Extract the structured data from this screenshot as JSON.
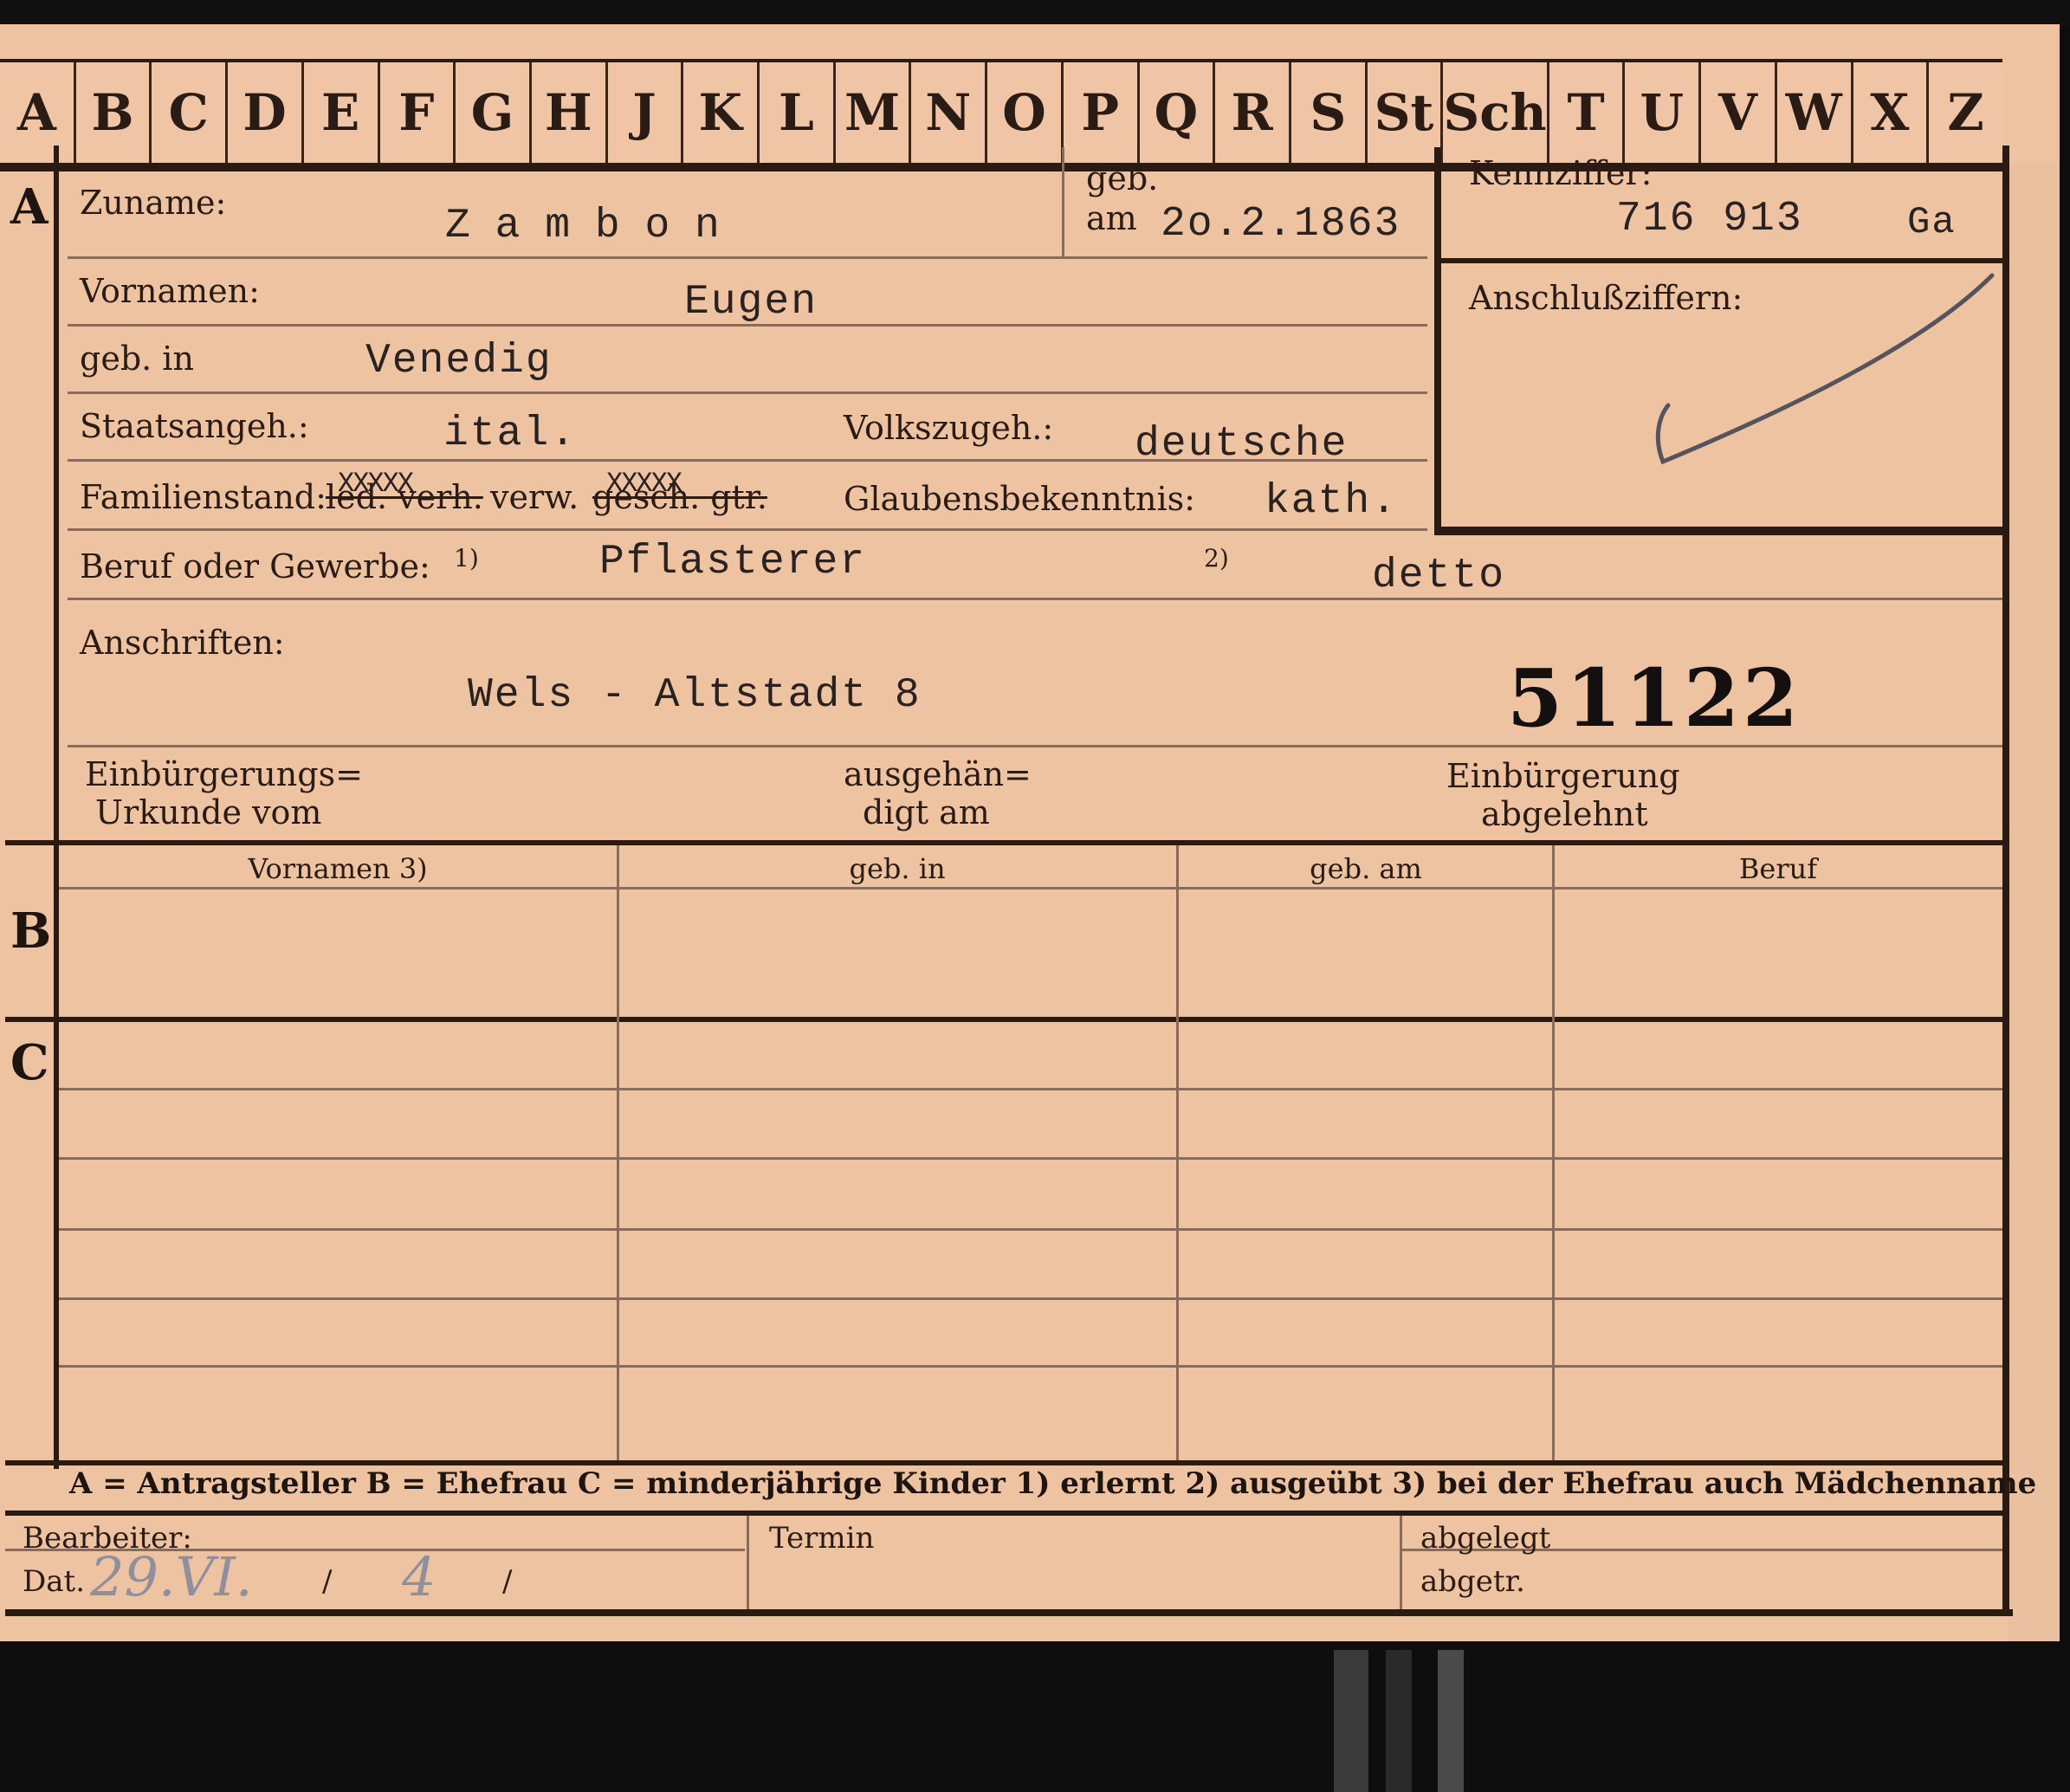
{
  "index_tabs": [
    "A",
    "B",
    "C",
    "D",
    "E",
    "F",
    "G",
    "H",
    "J",
    "K",
    "L",
    "M",
    "N",
    "O",
    "P",
    "Q",
    "R",
    "S",
    "St",
    "Sch",
    "T",
    "U",
    "V",
    "W",
    "X",
    "Z"
  ],
  "sections": {
    "a": "A",
    "b": "B",
    "c": "C"
  },
  "section_a": {
    "zuname_label": "Zuname:",
    "zuname_value": "Z a m b o n",
    "geb_label": "geb.",
    "am_label": "am",
    "geb_am_value": "2o.2.1863",
    "kennziffer_label": "Kennziffer:",
    "kennziffer_value": "716 913",
    "kennziffer_suffix": "Ga",
    "anschluss_label": "Anschlußziffern:",
    "vornamen_label": "Vornamen:",
    "vornamen_value": "Eugen",
    "geb_in_label": "geb. in",
    "geb_in_value": "Venedig",
    "staatsangeh_label": "Staatsangeh.:",
    "staatsangeh_value": "ital.",
    "volkszugeh_label": "Volkszugeh.:",
    "volkszugeh_value": "deutsche",
    "familienstand_label": "Familienstand:",
    "familienstand_led": "led. verh.",
    "familienstand_verw": "verw.",
    "familienstand_gesch": "gesch. gtr.",
    "strike_marks": "XXXXX",
    "glaubens_label": "Glaubensbekenntnis:",
    "glaubens_value": "kath.",
    "beruf_label": "Beruf oder Gewerbe:",
    "note1": "1)",
    "beruf_value": "Pflasterer",
    "note2": "2)",
    "beruf2_value": "detto",
    "anschriften_label": "Anschriften:",
    "anschriften_value": "Wels - Altstadt 8",
    "stamp_number": "51122",
    "einbuergerung_urkunde": [
      "Einbürgerungs=",
      "Urkunde vom"
    ],
    "ausgehaendigt": [
      "ausgehän=",
      "digt am"
    ],
    "einbuergerung_abgelehnt": [
      "Einbürgerung",
      "abgelehnt"
    ]
  },
  "section_b": {
    "columns": [
      "Vornamen 3)",
      "geb. in",
      "geb. am",
      "Beruf"
    ]
  },
  "legend": "A = Antragsteller   B = Ehefrau   C = minderjährige Kinder   1) erlernt   2) ausgeübt   3) bei der Ehefrau auch Mädchenname",
  "footer": {
    "bearbeiter_label": "Bearbeiter:",
    "dat_label": "Dat.",
    "dat_hand_day": "29.VI.",
    "dat_hand_year": "4",
    "slash": "/",
    "termin_label": "Termin",
    "abgelegt_label": "abgelegt",
    "abgetr_label": "abgetr."
  }
}
